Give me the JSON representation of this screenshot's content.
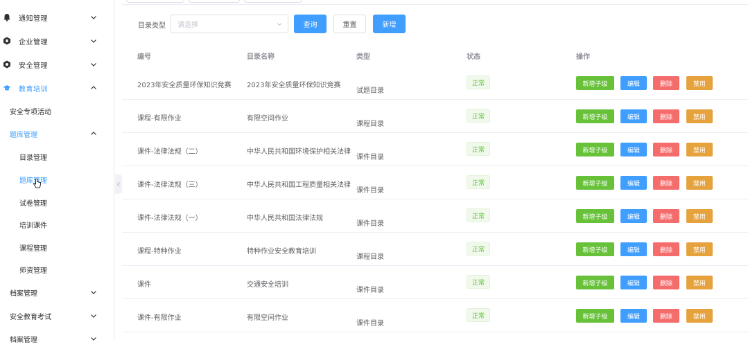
{
  "sidebar": {
    "items": [
      {
        "label": "通知管理",
        "icon": "bell-icon"
      },
      {
        "label": "企业管理",
        "icon": "building-icon"
      },
      {
        "label": "安全管理",
        "icon": "shield-icon"
      },
      {
        "label": "教育培训",
        "icon": "graduation-cap-icon"
      }
    ],
    "training_children": {
      "activity": "安全专项活动",
      "bank": "题库管理",
      "bank_children": [
        "目录管理",
        "题库管理",
        "试卷管理",
        "培训课件",
        "课程管理",
        "师资管理"
      ]
    },
    "after": [
      "档案管理",
      "安全教育考试",
      "档案管理"
    ]
  },
  "toolbar": {
    "type_label": "目录类型",
    "select_placeholder": "请选择",
    "query_button": "查询",
    "reset_button": "重置",
    "add_button": "新增"
  },
  "table": {
    "headers": [
      "编号",
      "目录名称",
      "类型",
      "状态",
      "操作"
    ],
    "rows": [
      {
        "code": "2023年安全质量环保知识竞赛",
        "name": "2023年安全质量环保知识竞赛",
        "type": "试题目录",
        "status": "正常"
      },
      {
        "code": "课程-有限作业",
        "name": "有限空间作业",
        "type": "课程目录",
        "status": "正常"
      },
      {
        "code": "课件-法律法规（二）",
        "name": "中华人民共和国环境保护相关法律",
        "type": "课件目录",
        "status": "正常"
      },
      {
        "code": "课件-法律法规（三）",
        "name": "中华人民共和国工程质量相关法律",
        "type": "课件目录",
        "status": "正常"
      },
      {
        "code": "课件-法律法规（一）",
        "name": "中华人民共和国法律法规",
        "type": "课件目录",
        "status": "正常"
      },
      {
        "code": "课程-特种作业",
        "name": "特种作业安全教育培训",
        "type": "课程目录",
        "status": "正常"
      },
      {
        "code": "课件",
        "name": "交通安全培训",
        "type": "课件目录",
        "status": "正常"
      },
      {
        "code": "课件-有限作业",
        "name": "有限空间作业",
        "type": "课件目录",
        "status": "正常"
      }
    ],
    "ops": {
      "add_child": "新增子级",
      "edit": "编辑",
      "delete": "删除",
      "disable": "禁用"
    }
  },
  "colors": {
    "primary": "#409eff",
    "success": "#67c23a",
    "danger": "#f56c6c",
    "warning": "#e6a23c"
  }
}
